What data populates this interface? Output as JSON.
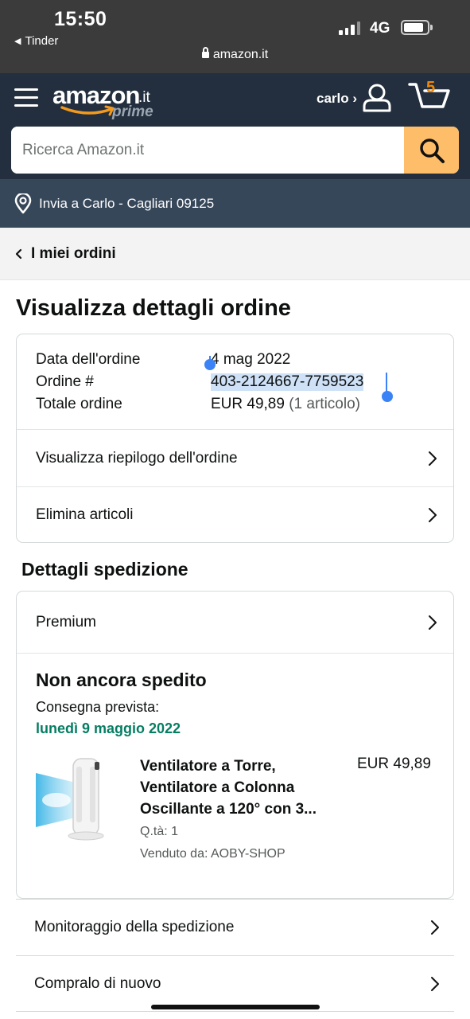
{
  "status_bar": {
    "time": "15:50",
    "back_app": "Tinder",
    "url": "amazon.it",
    "network": "4G"
  },
  "header": {
    "logo_word": "amazon",
    "logo_tld": ".it",
    "logo_sub": "prime",
    "account_label": "carlo ›",
    "cart_count": "5"
  },
  "search": {
    "placeholder": "Ricerca Amazon.it",
    "value": ""
  },
  "delivery": {
    "text": "Invia a Carlo - Cagliari 09125"
  },
  "breadcrumb": {
    "label": "I miei ordini"
  },
  "page": {
    "title": "Visualizza dettagli ordine"
  },
  "order_info": {
    "date_label": "Data dell'ordine",
    "date_value": "4 mag 2022",
    "number_label": "Ordine #",
    "number_value": "403-2124667-7759523",
    "total_label": "Totale ordine",
    "total_value": "EUR 49,89",
    "total_count": "(1 articolo)"
  },
  "order_links": {
    "summary": "Visualizza riepilogo dell'ordine",
    "delete_items": "Elimina articoli"
  },
  "shipping": {
    "section_title": "Dettagli spedizione",
    "method": "Premium",
    "status": "Non ancora spedito",
    "eta_label": "Consegna prevista:",
    "eta_date": "lunedì 9 maggio 2022",
    "product": {
      "title_line1": "Ventilatore a Torre,",
      "title_line2": "Ventilatore a Colonna",
      "title_line3": "Oscillante a 120° con 3...",
      "price": "EUR 49,89",
      "quantity": "Q.tà: 1",
      "seller": "Venduto da: AOBY-SHOP"
    }
  },
  "bottom_links": {
    "tracking": "Monitoraggio della spedizione",
    "buy_again": "Compralo di nuovo"
  },
  "colors": {
    "header_bg": "#232f3e",
    "deliver_bg": "#37475a",
    "search_button": "#febd69",
    "cart_count": "#f08804",
    "eta_green": "#067d62",
    "selection": "#3b82f6"
  }
}
